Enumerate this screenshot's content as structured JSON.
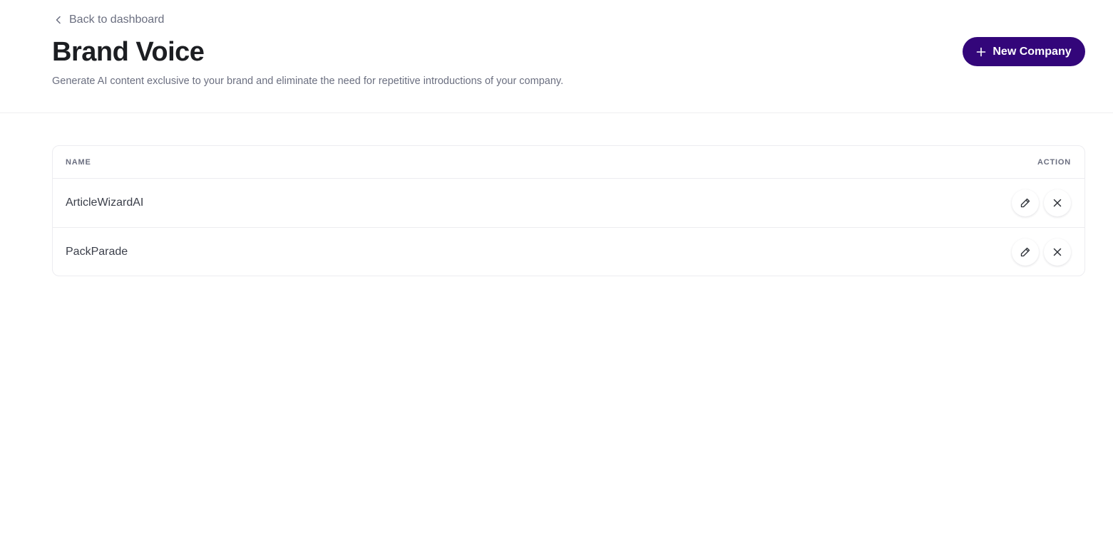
{
  "header": {
    "back_label": "Back to dashboard",
    "title": "Brand Voice",
    "description": "Generate AI content exclusive to your brand and eliminate the need for repetitive introductions of your company.",
    "new_button_label": "New Company"
  },
  "table": {
    "columns": [
      "NAME",
      "ACTION"
    ],
    "rows": [
      {
        "name": "ArticleWizardAI"
      },
      {
        "name": "PackParade"
      }
    ]
  },
  "icons": {
    "back": "chevron-left-icon",
    "new": "plus-icon",
    "edit": "pencil-icon",
    "delete": "close-icon"
  },
  "colors": {
    "accent": "#33067a",
    "muted_text": "#6b6f80",
    "title_text": "#1c1e22",
    "border": "#ececf0"
  }
}
